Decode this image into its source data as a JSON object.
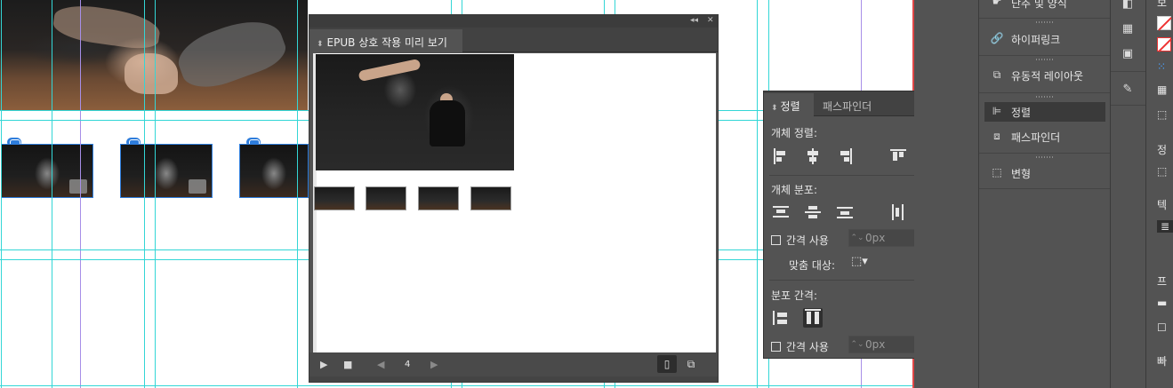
{
  "epub_panel": {
    "title": "EPUB 상호 작용 미리 보기",
    "topbar_collapse": "◂◂",
    "topbar_close": "✕",
    "page_number": "4",
    "play_icon": "play-icon",
    "stop_icon": "stop-icon"
  },
  "align_panel": {
    "tab_align": "정렬",
    "tab_pathfinder": "패스파인더",
    "align_objects_label": "개체 정렬:",
    "distribute_objects_label": "개체 분포:",
    "use_spacing_label": "간격 사용",
    "spacing_value": "0px",
    "align_to_label": "맞춤 대상:",
    "distribute_spacing_label": "분포 간격:",
    "use_spacing_label_2": "간격 사용",
    "spacing_value_2": "0px"
  },
  "dock": {
    "items": [
      {
        "label": "단추 및 양식",
        "icon": "button-forms-icon"
      },
      {
        "label": "하이퍼링크",
        "icon": "hyperlink-icon"
      },
      {
        "label": "유동적 레이아웃",
        "icon": "liquid-layout-icon"
      },
      {
        "label": "정렬",
        "icon": "align-icon",
        "active": true
      },
      {
        "label": "패스파인더",
        "icon": "pathfinder-icon"
      },
      {
        "label": "변형",
        "icon": "transform-icon"
      }
    ]
  },
  "right_panel": {
    "label_top": "보",
    "label_align": "정",
    "label_text": "텍",
    "label_frame": "프",
    "label_quick": "빠"
  }
}
